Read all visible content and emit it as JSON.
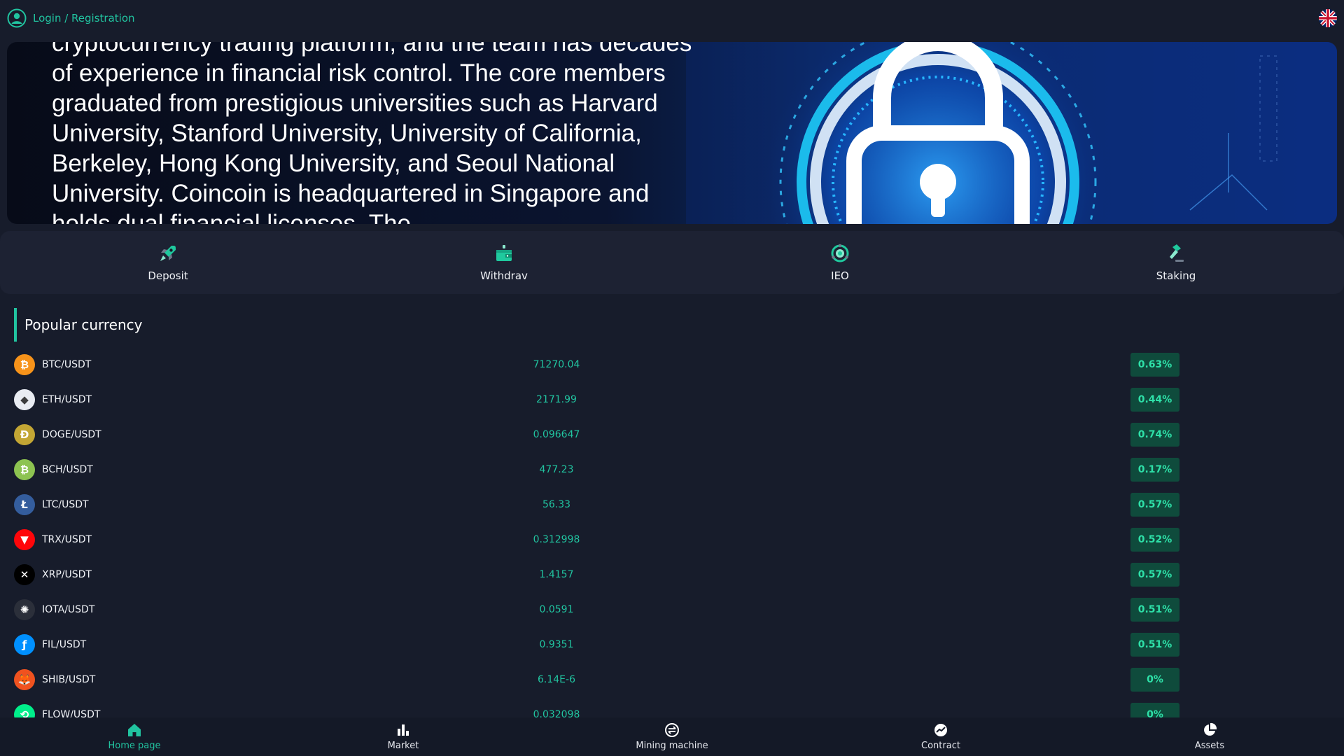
{
  "header": {
    "login_label": "Login / Registration",
    "language_icon": "uk-flag-icon"
  },
  "banner": {
    "text": "cryptocurrency trading platform, and the team has decades of experience in financial risk control. The core members graduated from prestigious universities such as Harvard University, Stanford University, University of California, Berkeley, Hong Kong University, and Seoul National University. Coincoin is headquartered in Singapore and holds dual financial licenses. The"
  },
  "actions": [
    {
      "label": "Deposit",
      "icon": "rocket-icon"
    },
    {
      "label": "Withdrav",
      "icon": "wallet-icon"
    },
    {
      "label": "IEO",
      "icon": "ieo-icon"
    },
    {
      "label": "Staking",
      "icon": "hammer-icon"
    }
  ],
  "popular": {
    "title": "Popular currency",
    "items": [
      {
        "pair": "BTC/USDT",
        "price": "71270.04",
        "change": "0.63%",
        "color": "#f7931a",
        "glyph": "₿"
      },
      {
        "pair": "ETH/USDT",
        "price": "2171.99",
        "change": "0.44%",
        "color": "#e9ecf2",
        "glyph": "◆"
      },
      {
        "pair": "DOGE/USDT",
        "price": "0.096647",
        "change": "0.74%",
        "color": "#c3a634",
        "glyph": "Ð"
      },
      {
        "pair": "BCH/USDT",
        "price": "477.23",
        "change": "0.17%",
        "color": "#8dc351",
        "glyph": "₿"
      },
      {
        "pair": "LTC/USDT",
        "price": "56.33",
        "change": "0.57%",
        "color": "#345d9d",
        "glyph": "Ł"
      },
      {
        "pair": "TRX/USDT",
        "price": "0.312998",
        "change": "0.52%",
        "color": "#ff060a",
        "glyph": "▼"
      },
      {
        "pair": "XRP/USDT",
        "price": "1.4157",
        "change": "0.57%",
        "color": "#000000",
        "glyph": "✕"
      },
      {
        "pair": "IOTA/USDT",
        "price": "0.0591",
        "change": "0.51%",
        "color": "#2b2f3a",
        "glyph": "✺"
      },
      {
        "pair": "FIL/USDT",
        "price": "0.9351",
        "change": "0.51%",
        "color": "#0090ff",
        "glyph": "ƒ"
      },
      {
        "pair": "SHIB/USDT",
        "price": "6.14E-6",
        "change": "0%",
        "color": "#f0521f",
        "glyph": "🦊"
      },
      {
        "pair": "FLOW/USDT",
        "price": "0.032098",
        "change": "0%",
        "color": "#00ef8b",
        "glyph": "⟲"
      }
    ]
  },
  "nav": [
    {
      "label": "Home page",
      "icon": "home-icon",
      "active": true
    },
    {
      "label": "Market",
      "icon": "bar-chart-icon",
      "active": false
    },
    {
      "label": "Mining machine",
      "icon": "exchange-icon",
      "active": false
    },
    {
      "label": "Contract",
      "icon": "trend-icon",
      "active": false
    },
    {
      "label": "Assets",
      "icon": "pie-icon",
      "active": false
    }
  ],
  "colors": {
    "accent": "#21c4a0",
    "background": "#171c2b",
    "panel": "#1d2233",
    "change_bg": "#0f4b3c"
  }
}
